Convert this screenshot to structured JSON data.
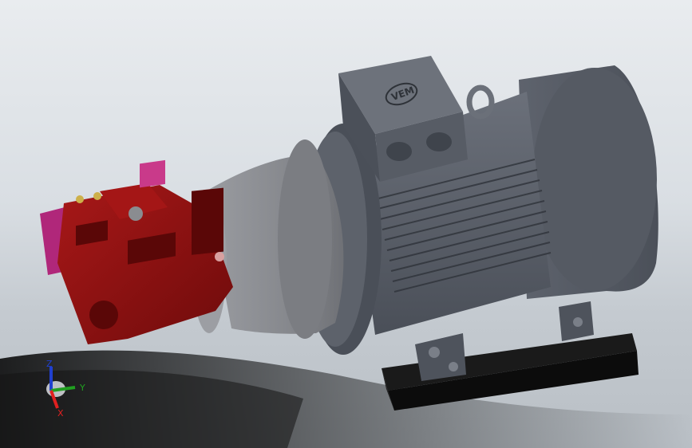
{
  "viewport": {
    "colors": {
      "background": "#dfe3e7",
      "pump": "#8b1010",
      "pump_shadow": "#5a0707",
      "manifold": "#b0277a",
      "motor": "#5a5f69",
      "motor_dark": "#3d424b",
      "bellhousing": "#8a8c91",
      "base": "#111111",
      "ground_shadow": "#2a2a2a"
    },
    "model": {
      "motor_logo": "VEM"
    },
    "triad": {
      "x_label": "X",
      "y_label": "Y",
      "z_label": "Z",
      "x_color": "#e02020",
      "y_color": "#20a020",
      "z_color": "#2040d0"
    }
  }
}
